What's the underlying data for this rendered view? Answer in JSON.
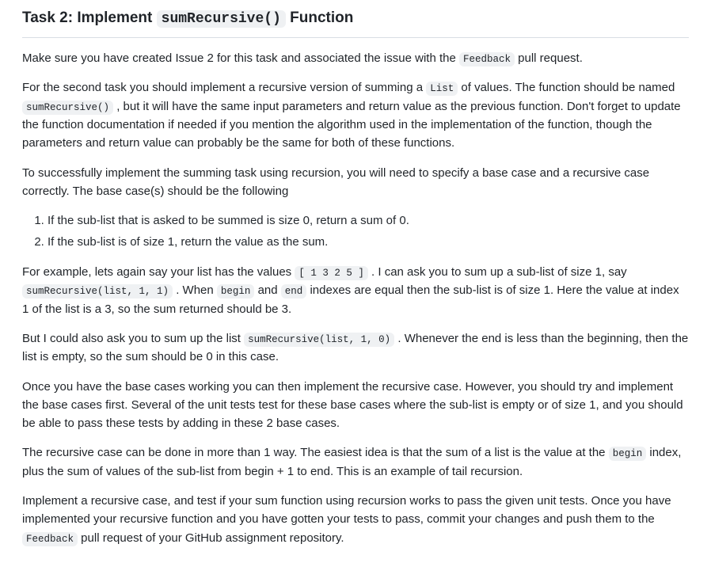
{
  "heading": {
    "prefix": "Task 2: Implement ",
    "code": "sumRecursive()",
    "suffix": " Function"
  },
  "p1": {
    "t1": "Make sure you have created Issue 2 for this task and associated the issue with the ",
    "c1": "Feedback",
    "t2": " pull request."
  },
  "p2": {
    "t1": "For the second task you should implement a recursive version of summing a ",
    "c1": "List",
    "t2": " of values. The function should be named ",
    "c2": "sumRecursive()",
    "t3": " , but it will have the same input parameters and return value as the previous function. Don't forget to update the function documentation if needed if you mention the algorithm used in the implementation of the function, though the parameters and return value can probably be the same for both of these functions."
  },
  "p3": "To successfully implement the summing task using recursion, you will need to specify a base case and a recursive case correctly. The base case(s) should be the following",
  "list": {
    "i1": "If the sub-list that is asked to be summed is size 0, return a sum of 0.",
    "i2": "If the sub-list is of size 1, return the value as the sum."
  },
  "p4": {
    "t1": "For example, lets again say your list has the values ",
    "c1": "[ 1 3 2 5 ]",
    "t2": " . I can ask you to sum up a sub-list of size 1, say ",
    "c2": "sumRecursive(list, 1, 1)",
    "t3": " . When ",
    "c3": "begin",
    "t4": " and ",
    "c4": "end",
    "t5": " indexes are equal then the sub-list is of size 1. Here the value at index 1 of the list is a 3, so the sum returned should be 3."
  },
  "p5": {
    "t1": "But I could also ask you to sum up the list ",
    "c1": "sumRecursive(list, 1, 0)",
    "t2": " . Whenever the end is less than the beginning, then the list is empty, so the sum should be 0 in this case."
  },
  "p6": "Once you have the base cases working you can then implement the recursive case. However, you should try and implement the base cases first. Several of the unit tests test for these base cases where the sub-list is empty or of size 1, and you should be able to pass these tests by adding in these 2 base cases.",
  "p7": {
    "t1": "The recursive case can be done in more than 1 way. The easiest idea is that the sum of a list is the value at the ",
    "c1": "begin",
    "t2": " index, plus the sum of values of the sub-list from begin + 1 to end. This is an example of tail recursion."
  },
  "p8": {
    "t1": "Implement a recursive case, and test if your sum function using recursion works to pass the given unit tests. Once you have implemented your recursive function and you have gotten your tests to pass, commit your changes and push them to the ",
    "c1": "Feedback",
    "t2": " pull request of your GitHub assignment repository."
  }
}
